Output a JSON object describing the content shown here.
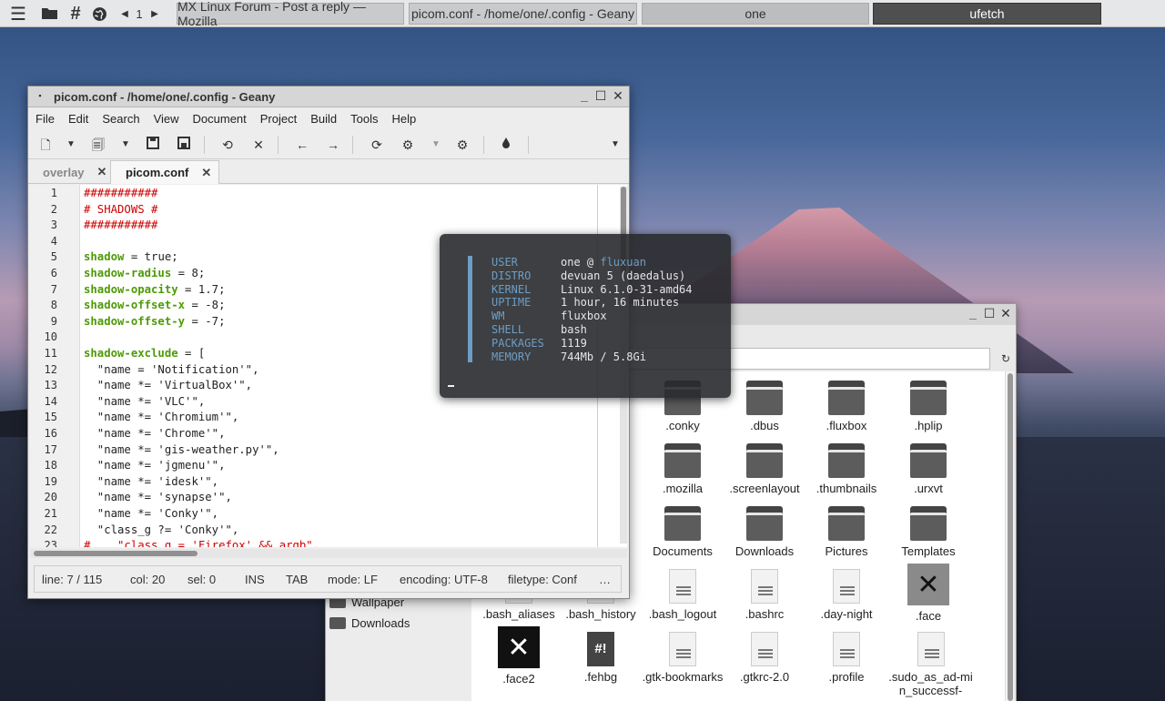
{
  "taskbar": {
    "page": "1",
    "tasks": [
      "MX Linux Forum - Post a reply — Mozilla",
      "picom.conf - /home/one/.config - Geany",
      "one",
      "ufetch"
    ]
  },
  "geany": {
    "title": "picom.conf - /home/one/.config - Geany",
    "menu": [
      "File",
      "Edit",
      "Search",
      "View",
      "Document",
      "Project",
      "Build",
      "Tools",
      "Help"
    ],
    "tabs": [
      {
        "label": "overlay",
        "close": "✕"
      },
      {
        "label": "picom.conf",
        "close": "✕"
      }
    ],
    "lines": [
      {
        "n": "1",
        "t": "###########",
        "c": "cm"
      },
      {
        "n": "2",
        "t": "# SHADOWS #",
        "c": "cm"
      },
      {
        "n": "3",
        "t": "###########",
        "c": "cm"
      },
      {
        "n": "4",
        "t": "",
        "c": "st"
      },
      {
        "n": "5",
        "k": "shadow",
        "t": " = true;",
        "c": "kv"
      },
      {
        "n": "6",
        "k": "shadow-radius",
        "t": " = 8;",
        "c": "kv"
      },
      {
        "n": "7",
        "k": "shadow-opacity",
        "t": " = 1.7;",
        "c": "kv"
      },
      {
        "n": "8",
        "k": "shadow-offset-x",
        "t": " = -8;",
        "c": "kv"
      },
      {
        "n": "9",
        "k": "shadow-offset-y",
        "t": " = -7;",
        "c": "kv"
      },
      {
        "n": "10",
        "t": "",
        "c": "st"
      },
      {
        "n": "11",
        "k": "shadow-exclude",
        "t": " = [",
        "c": "kv"
      },
      {
        "n": "12",
        "t": "  \"name = 'Notification'\",",
        "c": "st"
      },
      {
        "n": "13",
        "t": "  \"name *= 'VirtualBox'\",",
        "c": "st"
      },
      {
        "n": "14",
        "t": "  \"name *= 'VLC'\",",
        "c": "st"
      },
      {
        "n": "15",
        "t": "  \"name *= 'Chromium'\",",
        "c": "st"
      },
      {
        "n": "16",
        "t": "  \"name *= 'Chrome'\",",
        "c": "st"
      },
      {
        "n": "17",
        "t": "  \"name *= 'gis-weather.py'\",",
        "c": "st"
      },
      {
        "n": "18",
        "t": "  \"name *= 'jgmenu'\",",
        "c": "st"
      },
      {
        "n": "19",
        "t": "  \"name *= 'idesk'\",",
        "c": "st"
      },
      {
        "n": "20",
        "t": "  \"name *= 'synapse'\",",
        "c": "st"
      },
      {
        "n": "21",
        "t": "  \"name *= 'Conky'\",",
        "c": "st"
      },
      {
        "n": "22",
        "t": "  \"class_g ?= 'Conky'\",",
        "c": "st"
      },
      {
        "n": "23",
        "t": "#    \"class_g = 'Firefox' && argb\",",
        "c": "cm"
      }
    ],
    "status": {
      "line": "line: 7 / 115",
      "col": "col: 20",
      "sel": "sel: 0",
      "ins": "INS",
      "tab": "TAB",
      "mode": "mode: LF",
      "encoding": "encoding: UTF-8",
      "filetype": "filetype: Conf",
      "more": "…"
    }
  },
  "conky": {
    "rows": [
      {
        "k": "USER",
        "v": "one @ ",
        "h": "fluxuan"
      },
      {
        "k": "DISTRO",
        "v": "devuan 5 (daedalus)"
      },
      {
        "k": "KERNEL",
        "v": "Linux 6.1.0-31-amd64"
      },
      {
        "k": "UPTIME",
        "v": "1 hour, 16 minutes"
      },
      {
        "k": "WM",
        "v": "fluxbox"
      },
      {
        "k": "SHELL",
        "v": "bash"
      },
      {
        "k": "PACKAGES",
        "v": "1119"
      },
      {
        "k": "MEMORY",
        "v": "744Mb / 5.8Gi"
      }
    ],
    "accent": "#6e9dc4"
  },
  "filemanager": {
    "go": "↻",
    "sidebar": [
      "Wallpaper",
      "Downloads"
    ],
    "items": [
      ".conky",
      ".dbus",
      ".fluxbox",
      ".hplip",
      ".mozilla",
      ".screenlayout",
      ".thumbnails",
      ".urxvt",
      "Documents",
      "Downloads",
      "Pictures",
      "Templates",
      ".bash_aliases",
      ".bash_history",
      ".bash_logout",
      ".bashrc",
      ".day-night",
      ".face",
      ".face2",
      ".fehbg",
      ".gtk-bookmarks",
      ".gtkrc-2.0",
      ".profile",
      ".sudo_as_ad-min_successf-"
    ]
  }
}
